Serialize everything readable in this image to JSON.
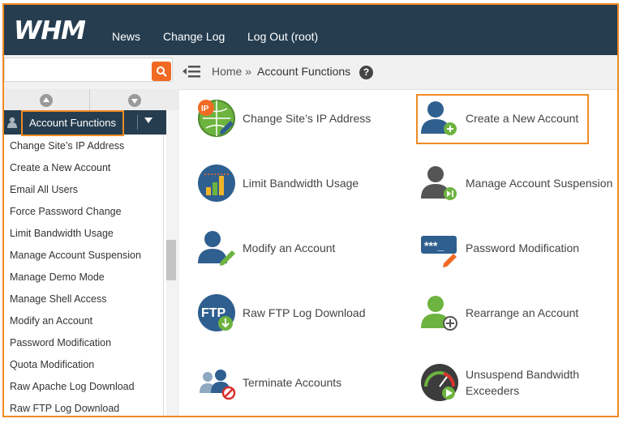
{
  "topbar": {
    "logo": "WHM",
    "nav": [
      "News",
      "Change Log",
      "Log Out (root)"
    ]
  },
  "search": {
    "placeholder": "",
    "button_icon": "search-icon"
  },
  "breadcrumb": {
    "home": "Home »",
    "current": "Account Functions",
    "help": "?"
  },
  "sidebar": {
    "category": "Account Functions",
    "items": [
      "Change Site’s IP Address",
      "Create a New Account",
      "Email All Users",
      "Force Password Change",
      "Limit Bandwidth Usage",
      "Manage Account Suspension",
      "Manage Demo Mode",
      "Manage Shell Access",
      "Modify an Account",
      "Password Modification",
      "Quota Modification",
      "Raw Apache Log Download",
      "Raw FTP Log Download"
    ]
  },
  "functions": {
    "col1": [
      {
        "label": "Change Site’s IP Address",
        "icon": "ip-address-icon"
      },
      {
        "label": "Limit Bandwidth Usage",
        "icon": "bandwidth-icon"
      },
      {
        "label": "Modify an Account",
        "icon": "modify-account-icon"
      },
      {
        "label": "Raw FTP Log Download",
        "icon": "ftp-download-icon"
      },
      {
        "label": "Terminate Accounts",
        "icon": "terminate-accounts-icon"
      }
    ],
    "col2": [
      {
        "label": "Create a New Account",
        "icon": "create-account-icon"
      },
      {
        "label": "Manage Account Suspension",
        "icon": "account-suspension-icon"
      },
      {
        "label": "Password Modification",
        "icon": "password-icon"
      },
      {
        "label": "Rearrange an Account",
        "icon": "rearrange-account-icon"
      },
      {
        "label_line1": "Unsuspend Bandwidth",
        "label_line2": "Exceeders",
        "icon": "unsuspend-bandwidth-icon"
      }
    ]
  },
  "colors": {
    "topbar": "#263d50",
    "accent": "#f08a24",
    "search_button": "#f06a23",
    "icon_blue": "#2f5f8f",
    "icon_green": "#6db33f"
  }
}
